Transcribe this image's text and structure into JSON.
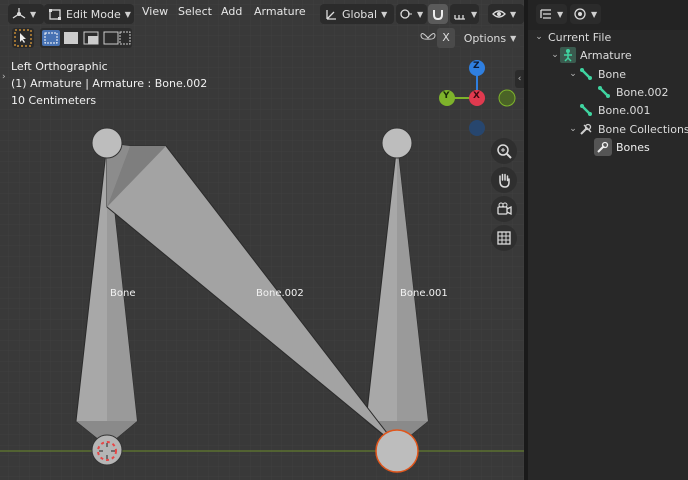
{
  "header": {
    "mode": "Edit Mode",
    "menus": [
      "View",
      "Select",
      "Add",
      "Armature"
    ],
    "transform_orientation": "Global",
    "options_label": "Options",
    "x_axis_label": "X"
  },
  "viewport": {
    "view_name": "Left Orthographic",
    "object_info": "(1) Armature | Armature : Bone.002",
    "scale_text": "10 Centimeters",
    "bone_labels": [
      "Bone",
      "Bone.002",
      "Bone.001"
    ]
  },
  "gizmo": {
    "z_label": "Z",
    "y_label": "Y",
    "x_label": "X",
    "colors": {
      "z": "#2f7fe0",
      "y": "#7eb32b",
      "x": "#e03a4f"
    }
  },
  "outliner": {
    "items": [
      {
        "label": "Current File",
        "icon": "current-file",
        "indent": 0,
        "expanded": true
      },
      {
        "label": "Armature",
        "icon": "armature-object-icon",
        "indent": 1,
        "expanded": true
      },
      {
        "label": "Bone",
        "icon": "bone-icon",
        "indent": 2,
        "expanded": true
      },
      {
        "label": "Bone.002",
        "icon": "bone-icon",
        "indent": 3
      },
      {
        "label": "Bone.001",
        "icon": "bone-icon",
        "indent": 2
      },
      {
        "label": "Bone Collections",
        "icon": "bone-collections-icon",
        "indent": 2,
        "expanded": true
      },
      {
        "label": "Bones",
        "icon": "bone-collection-icon",
        "indent": 3
      }
    ]
  },
  "colors": {
    "bone_fill": "#a6a6a6",
    "selected_joint_ring": "#e0561c",
    "x_axis_line": "#6b8a2a"
  }
}
